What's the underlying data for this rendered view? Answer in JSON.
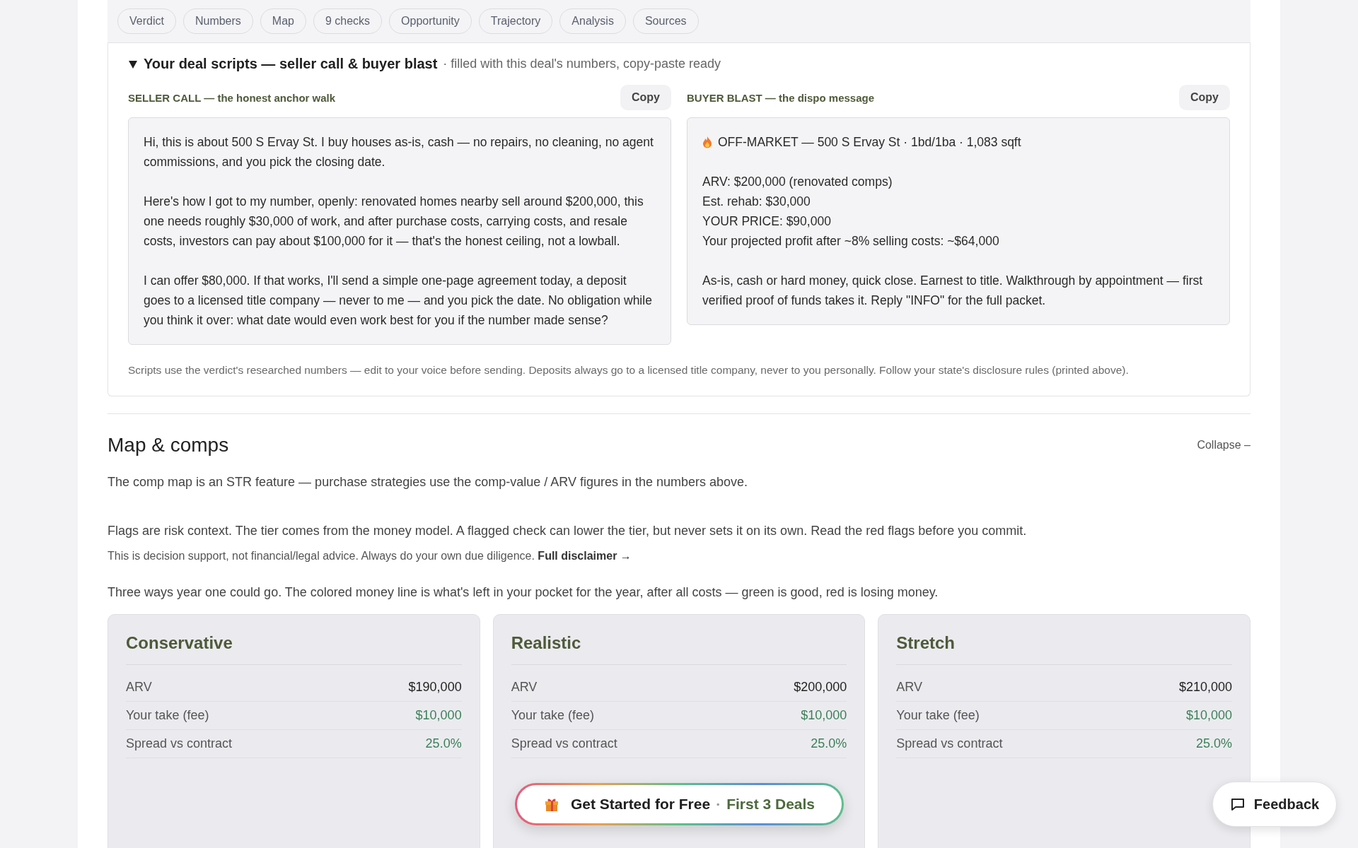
{
  "nav_tabs": [
    "Verdict",
    "Numbers",
    "Map",
    "9 checks",
    "Opportunity",
    "Trajectory",
    "Analysis",
    "Sources"
  ],
  "scripts": {
    "expanded": true,
    "title": "Your deal scripts — seller call & buyer blast",
    "subtitle": "· filled with this deal's numbers, copy-paste ready",
    "panels": [
      {
        "label": "SELLER CALL — the honest anchor walk",
        "button": "Copy",
        "paragraphs": [
          {
            "kind": "text",
            "lines": [
              "Hi, this is about 500 S Ervay St. I buy houses as-is, cash — no repairs, no cleaning, no agent commissions, and you pick the closing date."
            ]
          },
          {
            "kind": "text",
            "lines": [
              "Here's how I got to my number, openly: renovated homes nearby sell around $200,000, this one needs roughly $30,000 of work, and after purchase costs, carrying costs, and resale costs, investors can pay about $100,000 for it — that's the honest ceiling, not a lowball."
            ]
          },
          {
            "kind": "text",
            "lines": [
              "I can offer $80,000. If that works, I'll send a simple one-page agreement today, a deposit goes to a licensed title company — never to me — and you pick the date. No obligation while you think it over: what date would even work best for you if the number made sense?"
            ]
          }
        ]
      },
      {
        "label": "BUYER BLAST — the dispo message",
        "button": "Copy",
        "paragraphs": [
          {
            "kind": "headline",
            "lines": [
              "OFF-MARKET — 500 S Ervay St · 1bd/1ba · 1,083 sqft"
            ]
          },
          {
            "kind": "text",
            "lines": [
              "ARV: $200,000 (renovated comps)",
              "Est. rehab: $30,000",
              "YOUR PRICE: $90,000",
              "Your projected profit after ~8% selling costs: ~$64,000"
            ]
          },
          {
            "kind": "text",
            "lines": [
              "As-is, cash or hard money, quick close. Earnest to title. Walkthrough by appointment — first verified proof of funds takes it. Reply \"INFO\" for the full packet."
            ]
          }
        ]
      }
    ],
    "footnote": "Scripts use the verdict's researched numbers — edit to your voice before sending. Deposits always go to a licensed title company, never to you personally. Follow your state's disclosure rules (printed above)."
  },
  "map_section": {
    "title": "Map & comps",
    "toggle": "Collapse –",
    "note": "The comp map is an STR feature — purchase strategies use the comp-value / ARV figures in the numbers above.",
    "flags": "Flags are risk context. The tier comes from the money model. A flagged check can lower the tier, but never sets it on its own. Read the red flags before you commit.",
    "disclaimer": "This is decision support, not financial/legal advice. Always do your own due diligence.",
    "disclaimer_link": "Full disclaimer →",
    "intro": "Three ways year one could go. The colored money line is what's left in your pocket for the year, after all costs — green is good, red is losing money."
  },
  "scenarios": [
    {
      "title": "Conservative",
      "rows": [
        {
          "label": "ARV",
          "value": "$190,000",
          "kind": "plain"
        },
        {
          "label": "Your take (fee)",
          "value": "$10,000",
          "kind": "positive"
        },
        {
          "label": "Spread vs contract",
          "value": "25.0%",
          "kind": "positive"
        }
      ]
    },
    {
      "title": "Realistic",
      "rows": [
        {
          "label": "ARV",
          "value": "$200,000",
          "kind": "plain"
        },
        {
          "label": "Your take (fee)",
          "value": "$10,000",
          "kind": "positive"
        },
        {
          "label": "Spread vs contract",
          "value": "25.0%",
          "kind": "positive"
        }
      ]
    },
    {
      "title": "Stretch",
      "rows": [
        {
          "label": "ARV",
          "value": "$210,000",
          "kind": "plain"
        },
        {
          "label": "Your take (fee)",
          "value": "$10,000",
          "kind": "positive"
        },
        {
          "label": "Spread vs contract",
          "value": "25.0%",
          "kind": "positive"
        }
      ]
    }
  ],
  "cta": {
    "text": "Get Started for Free",
    "separator": "·",
    "highlight": "First 3 Deals"
  },
  "feedback": {
    "label": "Feedback"
  }
}
